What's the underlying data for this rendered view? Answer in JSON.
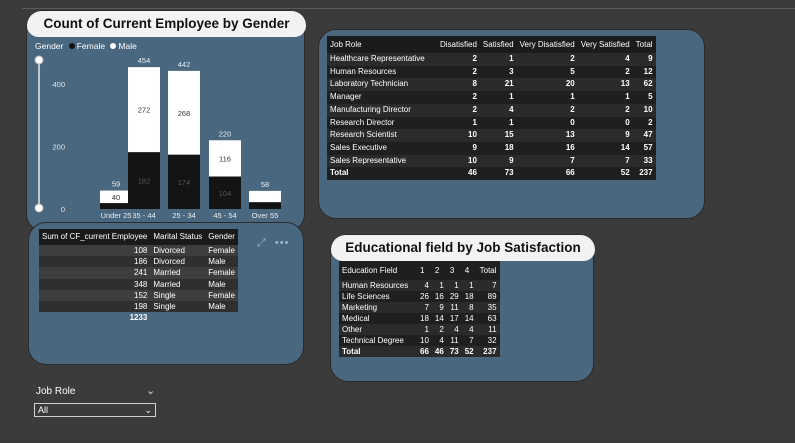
{
  "chart_panel": {
    "title": "Count of Current Employee by Gender",
    "legend": {
      "label": "Gender",
      "items": [
        {
          "name": "Female",
          "color": "#111111"
        },
        {
          "name": "Male",
          "color": "#ffffff"
        }
      ]
    }
  },
  "chart_data": {
    "type": "bar",
    "stacked": true,
    "title": "Count of Current Employee by Gender",
    "categories": [
      "Under 25",
      "35 - 44",
      "25 - 34",
      "45 - 54",
      "Over 55"
    ],
    "series": [
      {
        "name": "Female",
        "color": "#141414",
        "values": [
          19,
          182,
          174,
          104,
          22
        ]
      },
      {
        "name": "Male",
        "color": "#ffffff",
        "values": [
          40,
          272,
          268,
          116,
          36
        ]
      }
    ],
    "totals": [
      59,
      454,
      442,
      220,
      58
    ],
    "y_ticks": [
      0,
      200,
      400
    ],
    "ylim": [
      0,
      480
    ]
  },
  "emp_table": {
    "headers": [
      "Sum of CF_current Employee",
      "Marital Status",
      "Gender"
    ],
    "rows": [
      [
        "108",
        "Divorced",
        "Female"
      ],
      [
        "186",
        "Divorced",
        "Male"
      ],
      [
        "241",
        "Married",
        "Female"
      ],
      [
        "348",
        "Married",
        "Male"
      ],
      [
        "152",
        "Single",
        "Female"
      ],
      [
        "198",
        "Single",
        "Male"
      ]
    ],
    "total": "1233"
  },
  "job_table": {
    "headers": [
      "Job Role",
      "Disatisfied",
      "Satisfied",
      "Very Disatisfied",
      "Very Satisfied",
      "Total"
    ],
    "rows": [
      [
        "Healthcare Representative",
        "2",
        "1",
        "2",
        "4",
        "9"
      ],
      [
        "Human Resources",
        "2",
        "3",
        "5",
        "2",
        "12"
      ],
      [
        "Laboratory Technician",
        "8",
        "21",
        "20",
        "13",
        "62"
      ],
      [
        "Manager",
        "2",
        "1",
        "1",
        "1",
        "5"
      ],
      [
        "Manufacturing Director",
        "2",
        "4",
        "2",
        "2",
        "10"
      ],
      [
        "Research Director",
        "1",
        "1",
        "0",
        "0",
        "2"
      ],
      [
        "Research Scientist",
        "10",
        "15",
        "13",
        "9",
        "47"
      ],
      [
        "Sales Executive",
        "9",
        "18",
        "16",
        "14",
        "57"
      ],
      [
        "Sales Representative",
        "10",
        "9",
        "7",
        "7",
        "33"
      ]
    ],
    "total": [
      "Total",
      "46",
      "73",
      "66",
      "52",
      "237"
    ]
  },
  "edu_panel": {
    "title": "Educational field by Job Satisfaction"
  },
  "edu_table": {
    "headers": [
      "Education Field",
      "1",
      "2",
      "3",
      "4",
      "Total"
    ],
    "rows": [
      [
        "Human Resources",
        "4",
        "1",
        "1",
        "1",
        "7"
      ],
      [
        "Life Sciences",
        "26",
        "16",
        "29",
        "18",
        "89"
      ],
      [
        "Marketing",
        "7",
        "9",
        "11",
        "8",
        "35"
      ],
      [
        "Medical",
        "18",
        "14",
        "17",
        "14",
        "63"
      ],
      [
        "Other",
        "1",
        "2",
        "4",
        "4",
        "11"
      ],
      [
        "Technical Degree",
        "10",
        "4",
        "11",
        "7",
        "32"
      ]
    ],
    "total": [
      "Total",
      "66",
      "46",
      "73",
      "52",
      "237"
    ]
  },
  "slicer": {
    "label": "Job Role",
    "value": "All"
  },
  "icons": {
    "expand": "focus-mode-icon",
    "more": "more-options-icon",
    "chevron": "chevron-down-icon"
  }
}
